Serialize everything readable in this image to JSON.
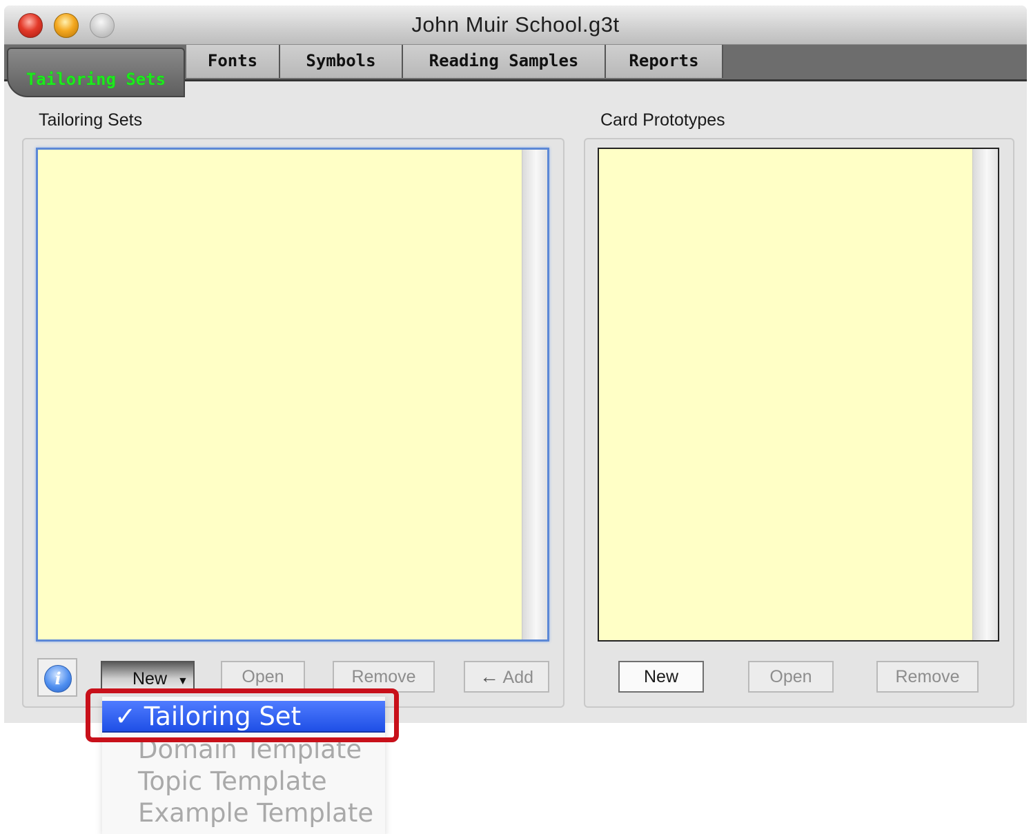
{
  "window": {
    "title": "John Muir School.g3t"
  },
  "tabs": [
    {
      "label": "Tailoring Sets",
      "active": true
    },
    {
      "label": "Fonts",
      "active": false
    },
    {
      "label": "Symbols",
      "active": false
    },
    {
      "label": "Reading Samples",
      "active": false
    },
    {
      "label": "Reports",
      "active": false
    }
  ],
  "left_panel": {
    "label": "Tailoring Sets",
    "buttons": {
      "new": "New",
      "open": "Open",
      "remove": "Remove",
      "add": "Add"
    }
  },
  "right_panel": {
    "label": "Card Prototypes",
    "buttons": {
      "new": "New",
      "open": "Open",
      "remove": "Remove"
    }
  },
  "new_menu": {
    "check_mark": "✓",
    "items": [
      {
        "label": "Tailoring Set",
        "selected": true
      },
      {
        "label": "Domain Template",
        "selected": false
      },
      {
        "label": "Topic Template",
        "selected": false
      },
      {
        "label": "Example Template",
        "selected": false
      }
    ]
  },
  "colors": {
    "list_background": "#ffffc6",
    "active_tab_text": "#1ee81e",
    "highlight": "#c8101a",
    "menu_selection": "#2a58ee"
  },
  "icons": {
    "info": "i",
    "add_arrow": "←",
    "dropdown": "▼"
  }
}
